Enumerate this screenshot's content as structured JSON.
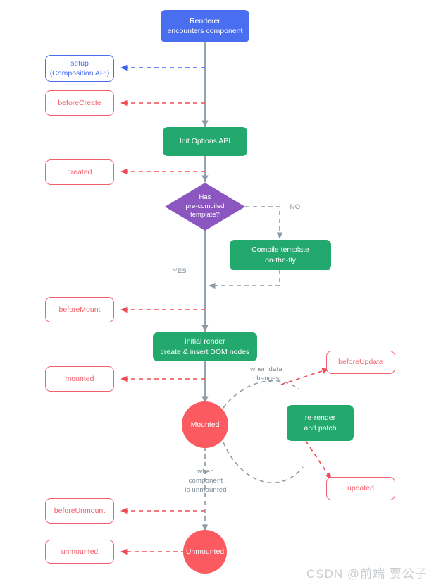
{
  "diagram": {
    "title": "Vue component lifecycle flowchart",
    "colors": {
      "blue": "#4a6ef0",
      "green": "#23a86d",
      "red": "#f2606b",
      "circle_red": "#fb5a60",
      "purple": "#8b56c0",
      "gray_edge": "#8b9aa4",
      "label_gray": "#7d8a94",
      "watermark_gray": "#c9ccd1",
      "background": "#ffffff"
    },
    "nodes": {
      "renderer": {
        "label": "Renderer\nencounters component",
        "kind": "process-blue"
      },
      "setup": {
        "label": "setup\n(Composition API)",
        "kind": "hook-blue"
      },
      "before_create": {
        "label": "beforeCreate",
        "kind": "hook-red"
      },
      "init_options": {
        "label": "Init Options API",
        "kind": "process-green"
      },
      "created": {
        "label": "created",
        "kind": "hook-red"
      },
      "decision": {
        "label": "Has\npre-compiled\ntemplate?",
        "kind": "decision-purple"
      },
      "compile_template": {
        "label": "Compile template\non-the-fly",
        "kind": "process-green"
      },
      "before_mount": {
        "label": "beforeMount",
        "kind": "hook-red"
      },
      "initial_render": {
        "label": "initial render\ncreate & insert DOM nodes",
        "kind": "process-green"
      },
      "mounted_hook": {
        "label": "mounted",
        "kind": "hook-red"
      },
      "mounted_state": {
        "label": "Mounted",
        "kind": "state-circle"
      },
      "before_update": {
        "label": "beforeUpdate",
        "kind": "hook-red"
      },
      "re_render": {
        "label": "re-render\nand patch",
        "kind": "process-green"
      },
      "updated": {
        "label": "updated",
        "kind": "hook-red"
      },
      "before_unmount": {
        "label": "beforeUnmount",
        "kind": "hook-red"
      },
      "unmounted_state": {
        "label": "Unmounted",
        "kind": "state-circle"
      },
      "unmounted_hook": {
        "label": "unmounted",
        "kind": "hook-red"
      }
    },
    "edge_labels": {
      "no": "NO",
      "yes": "YES",
      "when_data_changes": "when data\nchanges",
      "when_component_unmounted": "when\ncomponent\nis unmounted"
    },
    "watermark": "CSDN @前端 贾公子"
  }
}
